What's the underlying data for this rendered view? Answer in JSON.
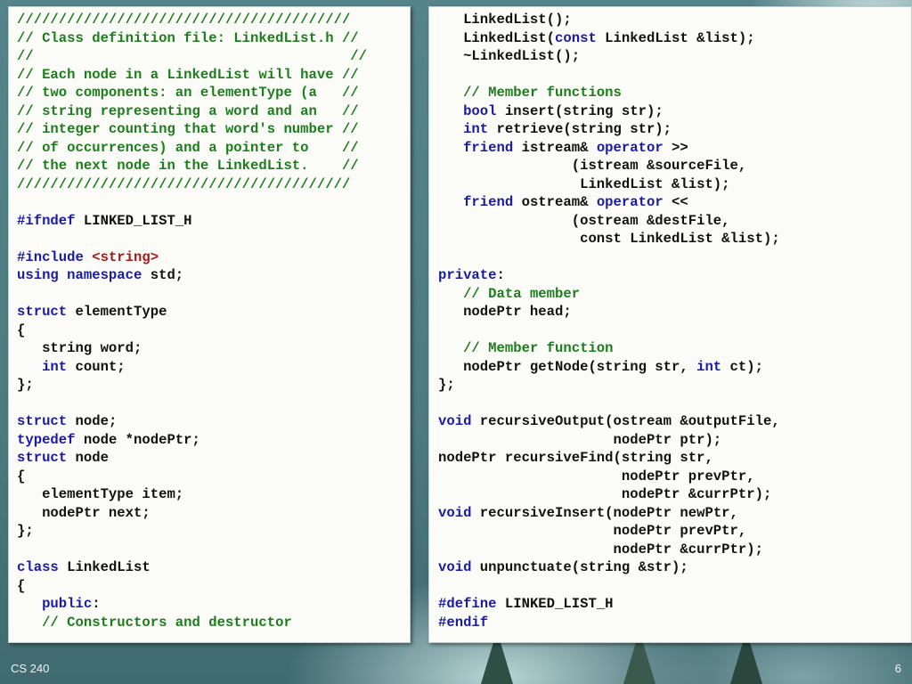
{
  "footer": {
    "course": "CS 240",
    "page_number": "6"
  },
  "left_code": {
    "l1": "////////////////////////////////////////",
    "l2": "// Class definition file: LinkedList.h //",
    "l3": "//                                      //",
    "l4": "// Each node in a LinkedList will have //",
    "l5": "// two components: an elementType (a   //",
    "l6": "// string representing a word and an   //",
    "l7": "// integer counting that word's number //",
    "l8": "// of occurrences) and a pointer to    //",
    "l9": "// the next node in the LinkedList.    //",
    "l10": "////////////////////////////////////////",
    "ifndef_kw": "#ifndef",
    "ifndef_rest": " LINKED_LIST_H",
    "include_kw": "#include",
    "include_str": "<string>",
    "using_kw": "using namespace",
    "using_rest": " std;",
    "struct_kw": "struct",
    "elementtype_name": " elementType",
    "open_brace": "{",
    "string_word": "   string word;",
    "int_kw": "int",
    "count_rest": " count;",
    "close_brace": "};",
    "node_fwd_rest": " node;",
    "typedef_kw": "typedef",
    "typedef_rest": " node *nodePtr;",
    "node_name": " node",
    "item_line": "   elementType item;",
    "next_line": "   nodePtr next;",
    "class_kw": "class",
    "class_rest": " LinkedList",
    "public_kw": "public",
    "colon": ":",
    "ctor_comment": "// Constructors and destructor"
  },
  "right_code": {
    "r1": "   LinkedList();",
    "r2a": "   LinkedList(",
    "const_kw": "const",
    "r2b": " LinkedList &list);",
    "r3": "   ~LinkedList();",
    "member_functions_comment": "// Member functions",
    "bool_kw": "bool",
    "insert_rest": " insert(string str);",
    "int_kw": "int",
    "retrieve_rest": " retrieve(string str);",
    "friend_kw": "friend",
    "istream_type": " istream& ",
    "operator_kw": "operator",
    "istream_op": " >>",
    "istream_param1": "                (istream &sourceFile,",
    "istream_param2": "                 LinkedList &list);",
    "ostream_type": " ostream& ",
    "ostream_op": " <<",
    "ostream_param1": "                (ostream &destFile,",
    "ostream_param2a": "                 ",
    "ostream_param2b": " LinkedList &list);",
    "private_kw": "private",
    "colon": ":",
    "data_member_comment": "// Data member",
    "head_line": "   nodePtr head;",
    "member_function_comment": "// Member function",
    "getnode_a": "   nodePtr getNode(string str, ",
    "getnode_b": " ct);",
    "close_brace": "};",
    "void_kw": "void",
    "output_rest": " recursiveOutput(ostream &outputFile,",
    "output_param2": "                     nodePtr ptr);",
    "find_line": "nodePtr recursiveFind(string str,",
    "find_param2": "                      nodePtr prevPtr,",
    "find_param3": "                      nodePtr &currPtr);",
    "insert_fn_rest": " recursiveInsert(nodePtr newPtr,",
    "insert_param2": "                     nodePtr prevPtr,",
    "insert_param3": "                     nodePtr &currPtr);",
    "unpunct_rest": " unpunctuate(string &str);",
    "define_kw": "#define",
    "define_rest": " LINKED_LIST_H",
    "endif_kw": "#endif"
  }
}
